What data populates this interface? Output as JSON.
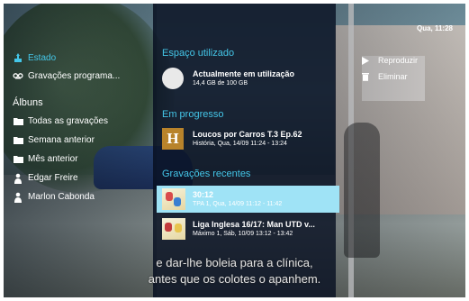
{
  "header": {
    "time": "Qua, 11:28"
  },
  "sidebar": {
    "items": [
      {
        "label": "Estado",
        "icon": "status-icon",
        "active": true
      },
      {
        "label": "Gravações programa...",
        "icon": "scheduled-recordings-icon",
        "active": false
      }
    ],
    "albums_title": "Álbuns",
    "albums": [
      {
        "label": "Todas as gravações",
        "icon": "folder-icon"
      },
      {
        "label": "Semana anterior",
        "icon": "folder-icon"
      },
      {
        "label": "Mês anterior",
        "icon": "folder-icon"
      },
      {
        "label": "Edgar Freire",
        "icon": "person-icon"
      },
      {
        "label": "Marlon Cabonda",
        "icon": "person-icon"
      }
    ]
  },
  "main": {
    "space": {
      "title": "Espaço utilizado",
      "line1": "Actualmente em utilização",
      "line2": "14,4 GB de 100 GB"
    },
    "in_progress": {
      "title": "Em progresso",
      "logo": "H",
      "line1": "Loucos por Carros T.3 Ep.62",
      "line2": "História, Qua, 14/09 11:24 - 13:24"
    },
    "recent": {
      "title": "Gravações recentes",
      "items": [
        {
          "line1": "30:12",
          "line2": "TPA 1, Qua, 14/09 11:12 - 11:42",
          "selected": true
        },
        {
          "line1": "Liga Inglesa 16/17: Man UTD v...",
          "line2": "Máximo 1, Sáb, 10/09 13:12 - 13:42",
          "selected": false
        }
      ]
    }
  },
  "actions": {
    "play": "Reproduzir",
    "delete": "Eliminar"
  },
  "subtitles": {
    "line1": "e dar-lhe boleia para a clínica,",
    "line2": "antes que os colotes o apanhem."
  },
  "colors": {
    "accent": "#44c6e8",
    "panel": "#08101f",
    "selected": "#9fe3f6"
  }
}
